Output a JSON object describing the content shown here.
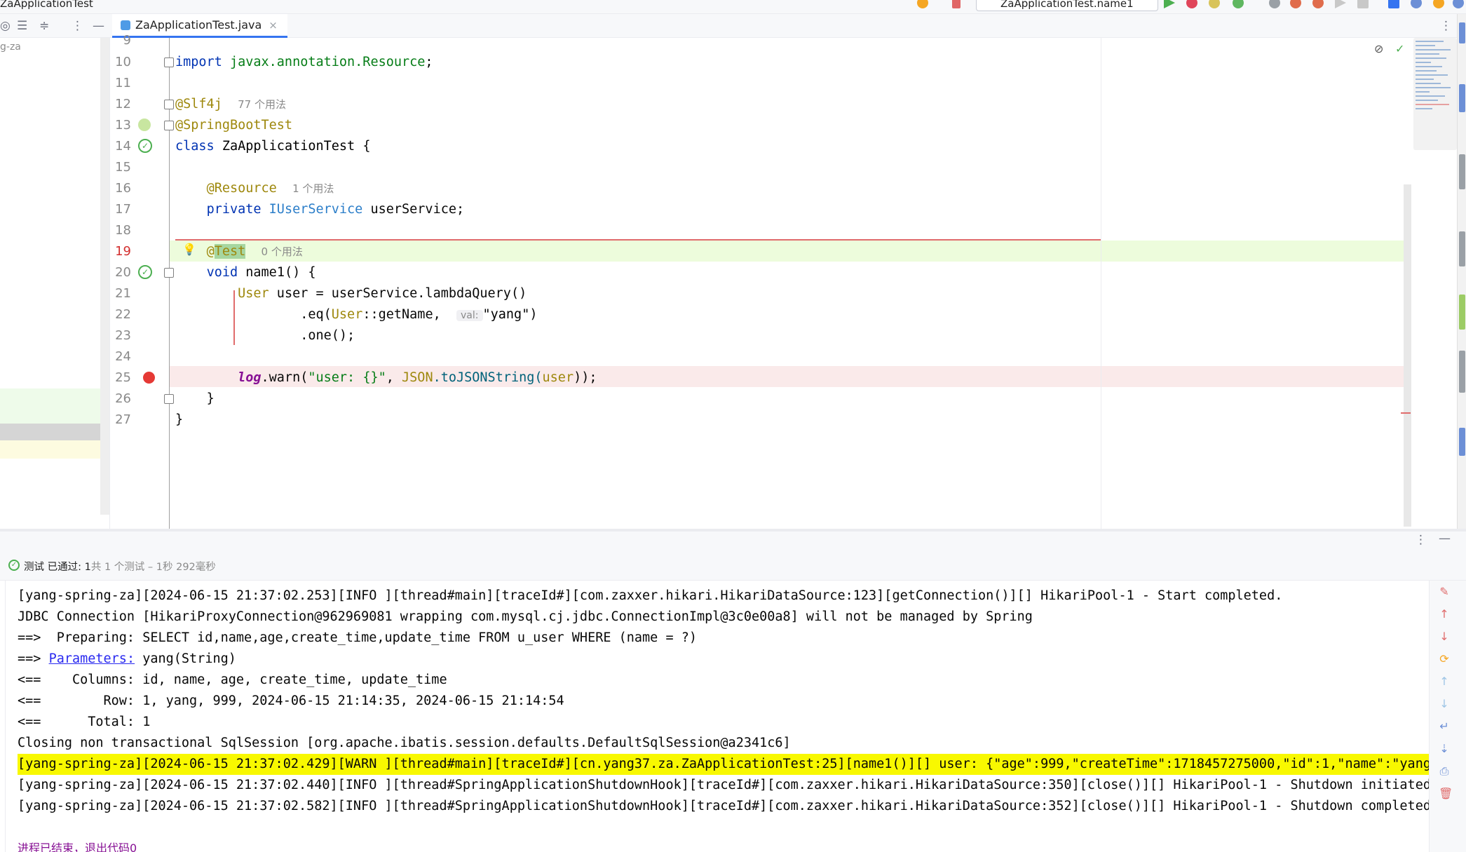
{
  "window": {
    "title": "ZaApplicationTest",
    "run_config": "ZaApplicationTest.name1"
  },
  "tab": {
    "label": "ZaApplicationTest.java",
    "close": "×"
  },
  "project": {
    "label": "g-za"
  },
  "editor": {
    "first_line_num": "9",
    "lines": [
      {
        "num": "10"
      },
      {
        "num": "11"
      },
      {
        "num": "12"
      },
      {
        "num": "13"
      },
      {
        "num": "14"
      },
      {
        "num": "15"
      },
      {
        "num": "16"
      },
      {
        "num": "17"
      },
      {
        "num": "18"
      },
      {
        "num": "19"
      },
      {
        "num": "20"
      },
      {
        "num": "21"
      },
      {
        "num": "22"
      },
      {
        "num": "23"
      },
      {
        "num": "24"
      },
      {
        "num": "25"
      },
      {
        "num": "26"
      },
      {
        "num": "27"
      }
    ],
    "code": {
      "l10_kw": "import",
      "l10_pkg": " javax.annotation.Resource",
      "l10_semi": ";",
      "l12_ann": "@Slf4j",
      "l12_hint": "77 个用法",
      "l13_ann": "@SpringBootTest",
      "l14_kw": "class",
      "l14_cls": " ZaApplicationTest",
      "l14_brace": " {",
      "l16_ann": "@Resource",
      "l16_hint": "1 个用法",
      "l17_kw": "private",
      "l17_type": " IUserService",
      "l17_rest": " userService;",
      "l19_ann_at": "@",
      "l19_ann_name": "Test",
      "l19_hint": "0 个用法",
      "l20_kw": "void",
      "l20_rest": " name1() {",
      "l21_type": "User",
      "l21_rest": " user = userService.lambdaQuery()",
      "l22_a": ".eq(",
      "l22_cls": "User",
      "l22_b": "::getName,",
      "l22_hint": "val:",
      "l22_str": "\"yang\"",
      "l22_c": ")",
      "l23": ".one();",
      "l25_log": "log",
      "l25_a": ".warn(",
      "l25_str": "\"user: {}\"",
      "l25_b": ", ",
      "l25_json": "JSON",
      "l25_c": ".toJSONString(",
      "l25_user": "user",
      "l25_d": "));",
      "l26": "}",
      "l27": "}"
    }
  },
  "run": {
    "status_prefix": "测试 已通过: ",
    "status_count": "1",
    "status_detail": "共 1 个测试 – 1秒 292毫秒",
    "console": {
      "line1": "[yang-spring-za][2024-06-15 21:37:02.253][INFO ][thread#main][traceId#][com.zaxxer.hikari.HikariDataSource:123][getConnection()][] HikariPool-1 - Start completed.",
      "line2": "JDBC Connection [HikariProxyConnection@962969081 wrapping com.mysql.cj.jdbc.ConnectionImpl@3c0e00a8] will not be managed by Spring",
      "line3": "==>  Preparing: SELECT id,name,age,create_time,update_time FROM u_user WHERE (name = ?)",
      "line4_prefix": "==> ",
      "line4_link": "Parameters:",
      "line4_rest": " yang(String)",
      "line5": "<==    Columns: id, name, age, create_time, update_time",
      "line6": "<==        Row: 1, yang, 999, 2024-06-15 21:14:35, 2024-06-15 21:14:54",
      "line7": "<==      Total: 1",
      "line8": "Closing non transactional SqlSession [org.apache.ibatis.session.defaults.DefaultSqlSession@a2341c6]",
      "line9": "[yang-spring-za][2024-06-15 21:37:02.429][WARN ][thread#main][traceId#][cn.yang37.za.ZaApplicationTest:25][name1()][] user: {\"age\":999,\"createTime\":1718457275000,\"id\":1,\"name\":\"yang\",",
      "line10": "[yang-spring-za][2024-06-15 21:37:02.440][INFO ][thread#SpringApplicationShutdownHook][traceId#][com.zaxxer.hikari.HikariDataSource:350][close()][] HikariPool-1 - Shutdown initiated..",
      "line11": "[yang-spring-za][2024-06-15 21:37:02.582][INFO ][thread#SpringApplicationShutdownHook][traceId#][com.zaxxer.hikari.HikariDataSource:352][close()][] HikariPool-1 - Shutdown completed.",
      "exit": "进程已结束，退出代码0"
    }
  },
  "colors": {
    "keyword": "#0033b3",
    "annotation": "#9e880d",
    "string": "#067d17",
    "warn_highlight": "#f8f800",
    "current_line": "#edfcdc",
    "breakpoint_line": "#faeaea",
    "breakpoint": "#e53935",
    "test_passed": "#4caf50"
  }
}
